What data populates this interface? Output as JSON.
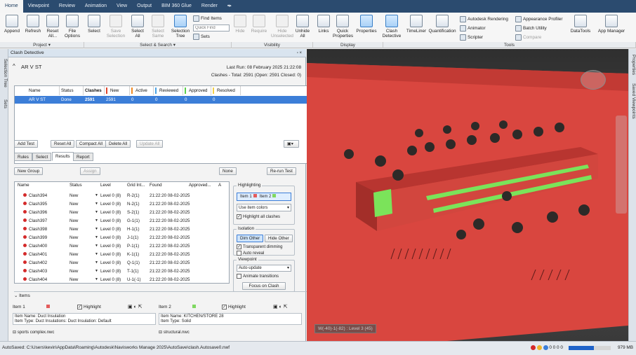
{
  "menu": {
    "tabs": [
      "Home",
      "Viewpoint",
      "Review",
      "Animation",
      "View",
      "Output",
      "BIM 360 Glue",
      "Render",
      "▪▸"
    ],
    "active": "Home"
  },
  "ribbon": {
    "append": "Append",
    "refresh": "Refresh",
    "reset_all": "Reset All...",
    "file_options": "File Options",
    "select": "Select",
    "save_selection": "Save Selection",
    "select_all": "Select All",
    "select_same": "Select Same",
    "selection_tree": "Selection Tree",
    "find_items": "Find Items",
    "quick_find_placeholder": "Quick Find",
    "sets": "Sets",
    "hide": "Hide",
    "require": "Require",
    "hide_unselected": "Hide Unselected",
    "unhide_all": "Unhide All",
    "links": "Links",
    "quick_properties": "Quick Properties",
    "properties": "Properties",
    "clash_detective": "Clash Detective",
    "timeliner": "TimeLiner",
    "quantification": "Quantification",
    "autodesk_rendering": "Autodesk Rendering",
    "animator": "Animator",
    "scripter": "Scripter",
    "appearance_profiler": "Appearance Profiler",
    "batch_utility": "Batch Utility",
    "compare": "Compare",
    "datatools": "DataTools",
    "app_manager": "App Manager",
    "groups": {
      "project": "Project ▾",
      "select_search": "Select & Search ▾",
      "visibility": "Visibility",
      "display": "Display",
      "tools": "Tools"
    }
  },
  "sidestrip": {
    "tabs": [
      "Selection Tree",
      "Sets"
    ]
  },
  "panel": {
    "title": "Clash Detective",
    "pin": "▫ ×",
    "test_name": "AR V ST",
    "last_run": "Last Run:  08 February 2025 21:22:08",
    "summary": "Clashes - Total: 2591  (Open: 2591  Closed: 0)",
    "columns": [
      "Name",
      "Status",
      "Clashes",
      "New",
      "Active",
      "Reviewed",
      "Approved",
      "Resolved"
    ],
    "test_row": [
      "AR V ST",
      "Done",
      "2591",
      "2591",
      "0",
      "0",
      "0",
      "0"
    ],
    "buttons": {
      "add_test": "Add Test",
      "reset_all": "Reset All",
      "compact_all": "Compact All",
      "delete_all": "Delete All",
      "update_all": "Update All"
    },
    "subtabs": [
      "Rules",
      "Select",
      "Results",
      "Report"
    ],
    "active_subtab": "Results",
    "results_toolbar": {
      "new_group": "New Group",
      "assign": "Assign",
      "none": "None",
      "rerun": "Re-run Test"
    },
    "results_columns": [
      "Name",
      "Status",
      "Level",
      "Grid Int...",
      "Found",
      "Approved...",
      "A"
    ],
    "results": [
      {
        "name": "Clash394",
        "status": "New",
        "level": "Level 0 (8)",
        "grid": "R-2(1)",
        "found": "21:22:20 08-02-2025"
      },
      {
        "name": "Clash395",
        "status": "New",
        "level": "Level 0 (8)",
        "grid": "N-2(1)",
        "found": "21:22:20 08-02-2025"
      },
      {
        "name": "Clash396",
        "status": "New",
        "level": "Level 0 (8)",
        "grid": "S-2(1)",
        "found": "21:22:20 08-02-2025"
      },
      {
        "name": "Clash397",
        "status": "New",
        "level": "Level 0 (8)",
        "grid": "G-1(1)",
        "found": "21:22:20 08-02-2025"
      },
      {
        "name": "Clash398",
        "status": "New",
        "level": "Level 0 (8)",
        "grid": "H-1(1)",
        "found": "21:22:20 08-02-2025"
      },
      {
        "name": "Clash399",
        "status": "New",
        "level": "Level 0 (8)",
        "grid": "J-1(1)",
        "found": "21:22:20 08-02-2025"
      },
      {
        "name": "Clash400",
        "status": "New",
        "level": "Level 0 (8)",
        "grid": "P-1(1)",
        "found": "21:22:20 08-02-2025"
      },
      {
        "name": "Clash401",
        "status": "New",
        "level": "Level 0 (8)",
        "grid": "K-1(1)",
        "found": "21:22:20 08-02-2025"
      },
      {
        "name": "Clash402",
        "status": "New",
        "level": "Level 0 (8)",
        "grid": "Q-1(1)",
        "found": "21:22:20 08-02-2025"
      },
      {
        "name": "Clash403",
        "status": "New",
        "level": "Level 0 (8)",
        "grid": "T-1(1)",
        "found": "21:22:20 08-02-2025"
      },
      {
        "name": "Clash404",
        "status": "New",
        "level": "Level 0 (8)",
        "grid": "U-1(-1)",
        "found": "21:22:20 08-02-2025"
      }
    ],
    "highlighting": {
      "label": "Highlighting",
      "item1": "Item 1",
      "item2": "Item 2",
      "use_colors": "Use item colors",
      "highlight_all": "Highlight all clashes"
    },
    "isolation": {
      "label": "Isolation",
      "dim_other": "Dim Other",
      "hide_other": "Hide Other",
      "transparent": "Transparent dimming",
      "auto_reveal": "Auto reveal"
    },
    "viewpoint": {
      "label": "Viewpoint",
      "auto_update": "Auto-update",
      "animate": "Animate transitions",
      "focus": "Focus on Clash"
    },
    "items": {
      "label": "Items",
      "item1": "Item 1",
      "item2": "Item 2",
      "highlight": "Highlight",
      "item1_name": "Item Name: Duct Insulation",
      "item1_type": "Item Type: Duct Insulations: Duct Insulation: Default",
      "item2_name": "Item Name: KITCHEN/STORE 28",
      "item2_type": "Item Type: Solid",
      "item1_file": "sports complex.nwc",
      "item2_file": "structural.nwc"
    }
  },
  "viewport": {
    "label": "W(-40)-1(-82) : Level 3 (45)"
  },
  "rightstrip": {
    "tabs": [
      "Properties",
      "Saved Viewpoints"
    ]
  },
  "status": {
    "autosave": "AutoSaved: C:\\Users\\kevin\\AppData\\Roaming\\Autodesk\\Navisworks Manage 2025\\AutoSave\\clash.Autosave0.nwf",
    "counts": "0  0  0  0",
    "memory": "979 MB"
  },
  "colors": {
    "menubar": "#2b4b6f",
    "selected_row": "#3c7ed8",
    "clash_red": "#d42a2a",
    "item1_color": "#e35c5c",
    "item2_color": "#7fd860",
    "building_red": "#d9463f",
    "building_green": "#7be35a"
  }
}
